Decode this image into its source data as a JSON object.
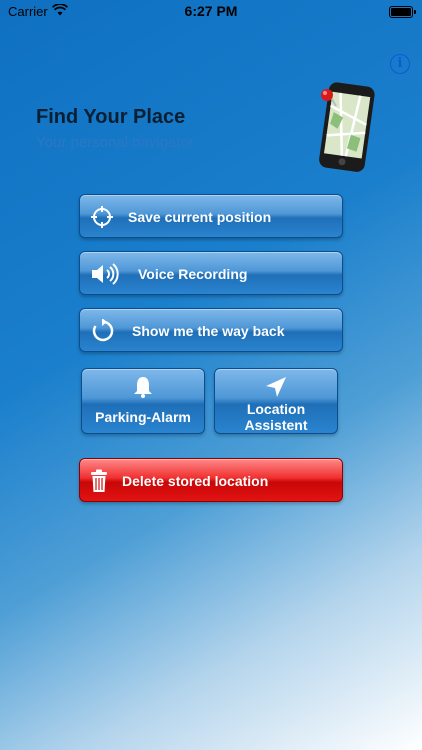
{
  "status_bar": {
    "carrier": "Carrier",
    "time": "6:27 PM"
  },
  "header": {
    "title": "Find Your Place",
    "subtitle": "Your personal navigator",
    "info_icon": "info-icon",
    "phone_icon": "phone-map-icon"
  },
  "buttons": {
    "save": {
      "label": "Save current position",
      "icon": "crosshair-icon"
    },
    "voice": {
      "label": "Voice Recording",
      "icon": "speaker-icon"
    },
    "way_back": {
      "label": "Show me the way back",
      "icon": "refresh-icon"
    },
    "parking": {
      "label": "Parking-Alarm",
      "icon": "bell-icon"
    },
    "location": {
      "label_line1": "Location",
      "label_line2": "Assistent",
      "icon": "navigation-arrow-icon"
    },
    "delete": {
      "label": "Delete stored location",
      "icon": "trash-icon"
    }
  },
  "colors": {
    "accent_blue": "#1a7fcc",
    "delete_red": "#e21313",
    "info_blue": "#0a5bd8"
  }
}
